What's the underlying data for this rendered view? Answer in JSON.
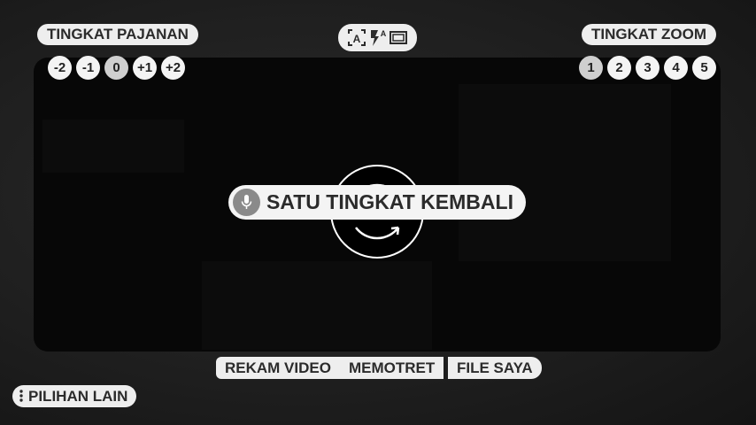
{
  "exposure": {
    "title": "TINGKAT PAJANAN",
    "levels": [
      "-2",
      "-1",
      "0",
      "+1",
      "+2"
    ],
    "selected": "0"
  },
  "zoom": {
    "title": "TINGKAT ZOOM",
    "levels": [
      "1",
      "2",
      "3",
      "4",
      "5"
    ],
    "selected": "1"
  },
  "mode_icons": [
    "auto-focus-icon",
    "flash-auto-icon",
    "aspect-ratio-icon"
  ],
  "voice_toast": {
    "icon": "microphone-icon",
    "text": "SATU TINGKAT KEMBALI"
  },
  "bottom_bar": {
    "record_video": "REKAM VIDEO",
    "take_photo": "MEMOTRET",
    "my_files": "FILE SAYA"
  },
  "more_options": "PILIHAN LAIN",
  "colors": {
    "pill_bg": "#eeeeee",
    "pill_text": "#2b2b2b",
    "selected_level": "#cfcfcf",
    "mic_bg": "#8a8a8a",
    "viewfinder": "#070707"
  }
}
